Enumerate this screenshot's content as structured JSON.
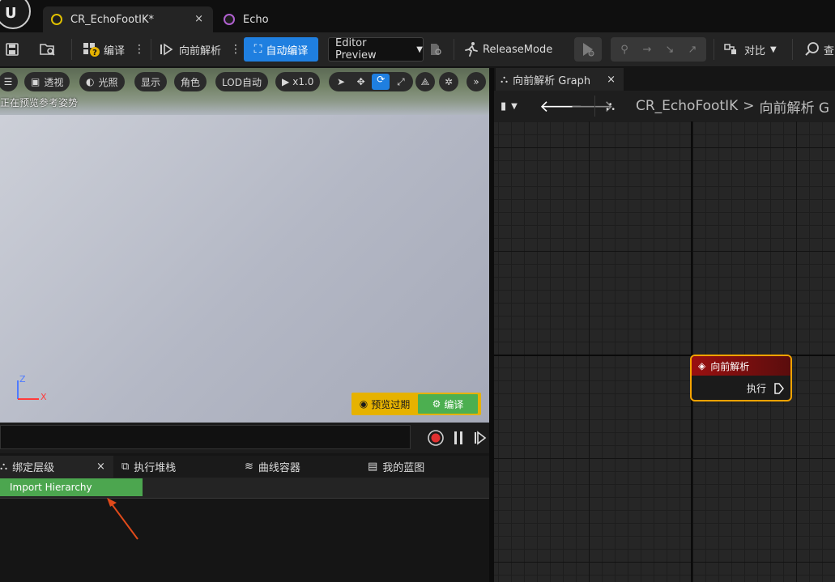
{
  "tabs": [
    {
      "label": "CR_EchoFootIK*",
      "icon": "control-rig-icon",
      "color": "#e0c000"
    },
    {
      "label": "Echo",
      "icon": "skeleton-icon",
      "color": "#b060d0"
    }
  ],
  "tab_close": "×",
  "toolbar": {
    "compile": "编译",
    "forward_solve": "向前解析",
    "auto_compile": "自动编译",
    "editor_preview": "Editor Preview",
    "release_mode": "ReleaseMode",
    "diff": "对比",
    "search": "查"
  },
  "viewport": {
    "menu": "☰",
    "perspective": "透视",
    "lit": "光照",
    "show": "显示",
    "character": "角色",
    "lod": "LOD自动",
    "speed": "x1.0",
    "status": "正在预览参考姿势",
    "axis_z": "Z",
    "axis_x": "X",
    "preview_expired": "预览过期",
    "compile": "编译"
  },
  "bottom_tabs": [
    {
      "label": "绑定层级",
      "icon": "hierarchy-icon"
    },
    {
      "label": "执行堆栈",
      "icon": "stack-icon"
    },
    {
      "label": "曲线容器",
      "icon": "curve-icon"
    },
    {
      "label": "我的蓝图",
      "icon": "book-icon"
    }
  ],
  "import_hierarchy": "Import Hierarchy",
  "graph": {
    "tab_label": "向前解析 Graph",
    "breadcrumb_root": "CR_EchoFootIK",
    "breadcrumb_sep": ">",
    "breadcrumb_current": "向前解析 G",
    "node_title": "向前解析",
    "node_exec": "执行"
  },
  "colors": {
    "accent": "#1f7fe0",
    "compile_green": "#4caf50",
    "warning_yellow": "#e6b200",
    "node_border": "#f5a300",
    "node_header": "#9a1010"
  }
}
